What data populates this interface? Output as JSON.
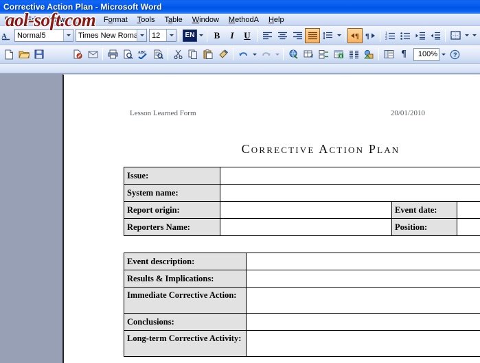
{
  "window": {
    "title": "Corrective Action Plan - Microsoft Word",
    "watermark": "aol-soft.com",
    "titlebar_color": "#0a5ff0"
  },
  "menubar": {
    "items": [
      {
        "label": "File",
        "accel": "F"
      },
      {
        "label": "Edit",
        "accel": "E"
      },
      {
        "label": "View",
        "accel": "V"
      },
      {
        "label": "Insert",
        "accel": "I"
      },
      {
        "label": "Format",
        "accel": "o"
      },
      {
        "label": "Tools",
        "accel": "T"
      },
      {
        "label": "Table",
        "accel": "a"
      },
      {
        "label": "Window",
        "accel": "W"
      },
      {
        "label": "MethodA",
        "accel": "M"
      },
      {
        "label": "Help",
        "accel": "H"
      }
    ]
  },
  "formatting_toolbar": {
    "style_value": "Normal5",
    "font_value": "Times New Roman",
    "size_value": "12",
    "language_value": "EN",
    "bold_label": "B",
    "italic_label": "I",
    "underline_label": "U",
    "buttons": [
      "style-combo",
      "font-combo",
      "size-combo",
      "language-button",
      "bold",
      "italic",
      "underline",
      "align-left",
      "align-center",
      "align-right",
      "align-justify",
      "line-spacing",
      "ltr-text-direction",
      "rtl-text-direction",
      "numbered-list",
      "bulleted-list",
      "decrease-indent",
      "increase-indent",
      "borders"
    ],
    "pressed": [
      "align-justify",
      "ltr-text-direction"
    ]
  },
  "standard_toolbar": {
    "zoom_value": "100%",
    "buttons": [
      "new-document",
      "open",
      "save",
      "permission",
      "email",
      "print",
      "print-preview",
      "spelling-grammar",
      "research",
      "cut",
      "copy",
      "paste",
      "format-painter",
      "undo",
      "redo",
      "insert-hyperlink",
      "tables-and-borders",
      "insert-table",
      "insert-excel-spreadsheet",
      "columns",
      "drawing",
      "document-map",
      "show-formatting-marks",
      "zoom",
      "help"
    ]
  },
  "document": {
    "header_left": "Lesson Learned Form",
    "header_right": "20/01/2010",
    "title": "Corrective Action Plan",
    "table1": {
      "rows": [
        {
          "label": "Issue:",
          "value": "",
          "label2": null,
          "value2": null
        },
        {
          "label": "System name:",
          "value": "",
          "label2": null,
          "value2": null
        },
        {
          "label": "Report origin:",
          "value": "",
          "label2": "Event date:",
          "value2": ""
        },
        {
          "label": "Reporters Name:",
          "value": "",
          "label2": "Position:",
          "value2": ""
        }
      ]
    },
    "table2": {
      "rows": [
        {
          "label": "Event description:",
          "value": ""
        },
        {
          "label": "Results & Implications:",
          "value": ""
        },
        {
          "label": "Immediate Corrective Action:",
          "value": ""
        },
        {
          "label": "Conclusions:",
          "value": ""
        },
        {
          "label": "Long-term Corrective Activity:",
          "value": ""
        }
      ]
    }
  }
}
